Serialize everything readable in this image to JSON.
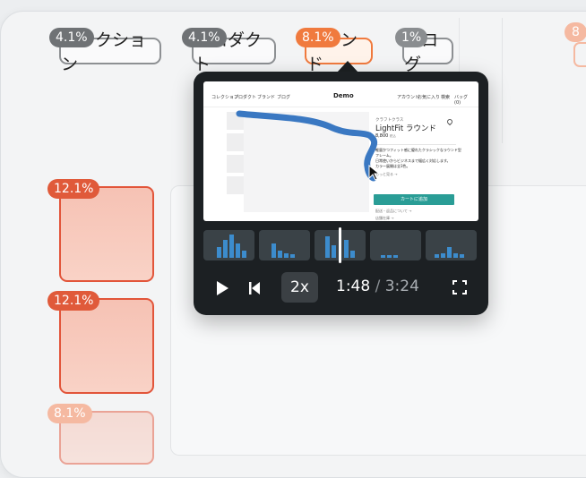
{
  "nav": {
    "items": [
      {
        "label": "コレクション",
        "pct": "4.1%",
        "active": false
      },
      {
        "label": "プロダクト",
        "pct": "4.1%",
        "active": false
      },
      {
        "label": "ブランド",
        "pct": "8.1%",
        "active": true
      },
      {
        "label": "ブログ",
        "pct": "1%",
        "active": false
      }
    ],
    "overflow_pct": "8"
  },
  "heatmap": {
    "boxes": [
      {
        "pct": "12.1%"
      },
      {
        "pct": "12.1%"
      },
      {
        "pct": "8.1%"
      }
    ]
  },
  "preview": {
    "nav_items": [
      "コレクション",
      "プロダクト",
      "ブランド",
      "ブログ"
    ],
    "logo": "Demo",
    "nav_right": [
      "アカウント",
      "お気に入り",
      "検索",
      "バッグ (0)"
    ],
    "brand_caption": "クラフトクラス",
    "product_title": "LightFit ラウンド",
    "price": "8,800",
    "price_suffix": "税込",
    "desc_line1": "軽量かつフィット感に優れたクラシックなラウンド型",
    "desc_line2": "フレーム。",
    "desc_line3": "日常使いからビジネスまで幅広く対応します。",
    "desc_line4": "カラー展開は全3色。",
    "more_link": "もっと見る →",
    "cart_button": "カートに追加",
    "shipping_link": "配送・返品について →",
    "store_link": "店舗在庫 →"
  },
  "player": {
    "speed": "2x",
    "current_time": "1:48",
    "separator": "/",
    "duration": "3:24",
    "progress": 0.53
  },
  "colors": {
    "accent": "#f07a3e",
    "heat": "#e2553a",
    "teal": "#2a9d96",
    "path": "#3a78c2"
  }
}
